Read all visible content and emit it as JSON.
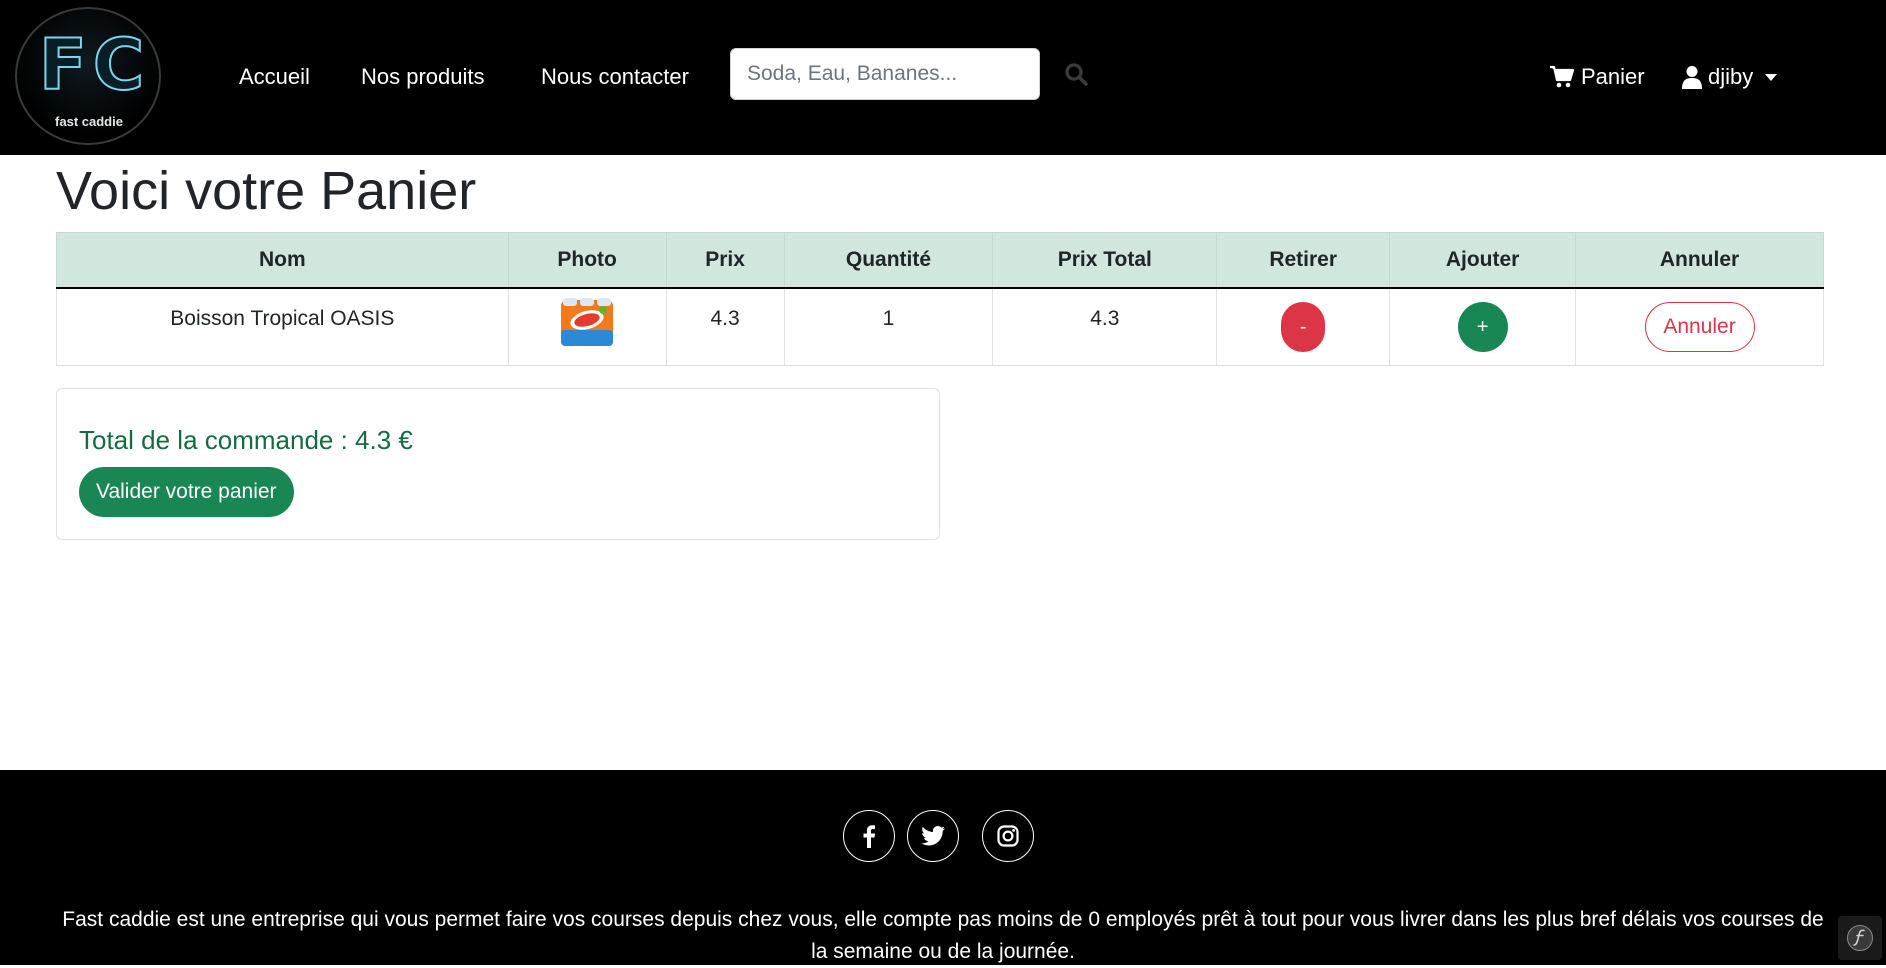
{
  "brand": {
    "logo_letters": "FC",
    "logo_subtitle": "fast caddie"
  },
  "nav": {
    "links": [
      "Accueil",
      "Nos produits",
      "Nous contacter"
    ],
    "search_placeholder": "Soda, Eau, Bananes...",
    "cart_label": "Panier",
    "user_label": "djiby"
  },
  "page": {
    "title": "Voici votre Panier"
  },
  "cart_table": {
    "headers": [
      "Nom",
      "Photo",
      "Prix",
      "Quantité",
      "Prix Total",
      "Retirer",
      "Ajouter",
      "Annuler"
    ],
    "rows": [
      {
        "name": "Boisson Tropical OASIS",
        "photo_icon": "oasis-pack-image",
        "price": "4.3",
        "quantity": "1",
        "total": "4.3",
        "remove_label": "-",
        "add_label": "+",
        "cancel_label": "Annuler"
      }
    ]
  },
  "summary": {
    "total_text": "Total de la commande : 4.3 €",
    "validate_label": "Valider votre panier"
  },
  "footer": {
    "social_icons": [
      "facebook-icon",
      "twitter-icon",
      "instagram-icon"
    ],
    "text": "Fast caddie est une entreprise qui vous permet faire vos courses depuis chez vous, elle compte pas moins de 0 employés prêt à tout pour vous livrer dans les plus bref délais vos courses de la semaine ou de la journée."
  },
  "colors": {
    "navbar_bg": "#000000",
    "header_row_bg": "#d1e7dd",
    "success": "#198754",
    "danger": "#dc3545",
    "total_text": "#146c43"
  }
}
